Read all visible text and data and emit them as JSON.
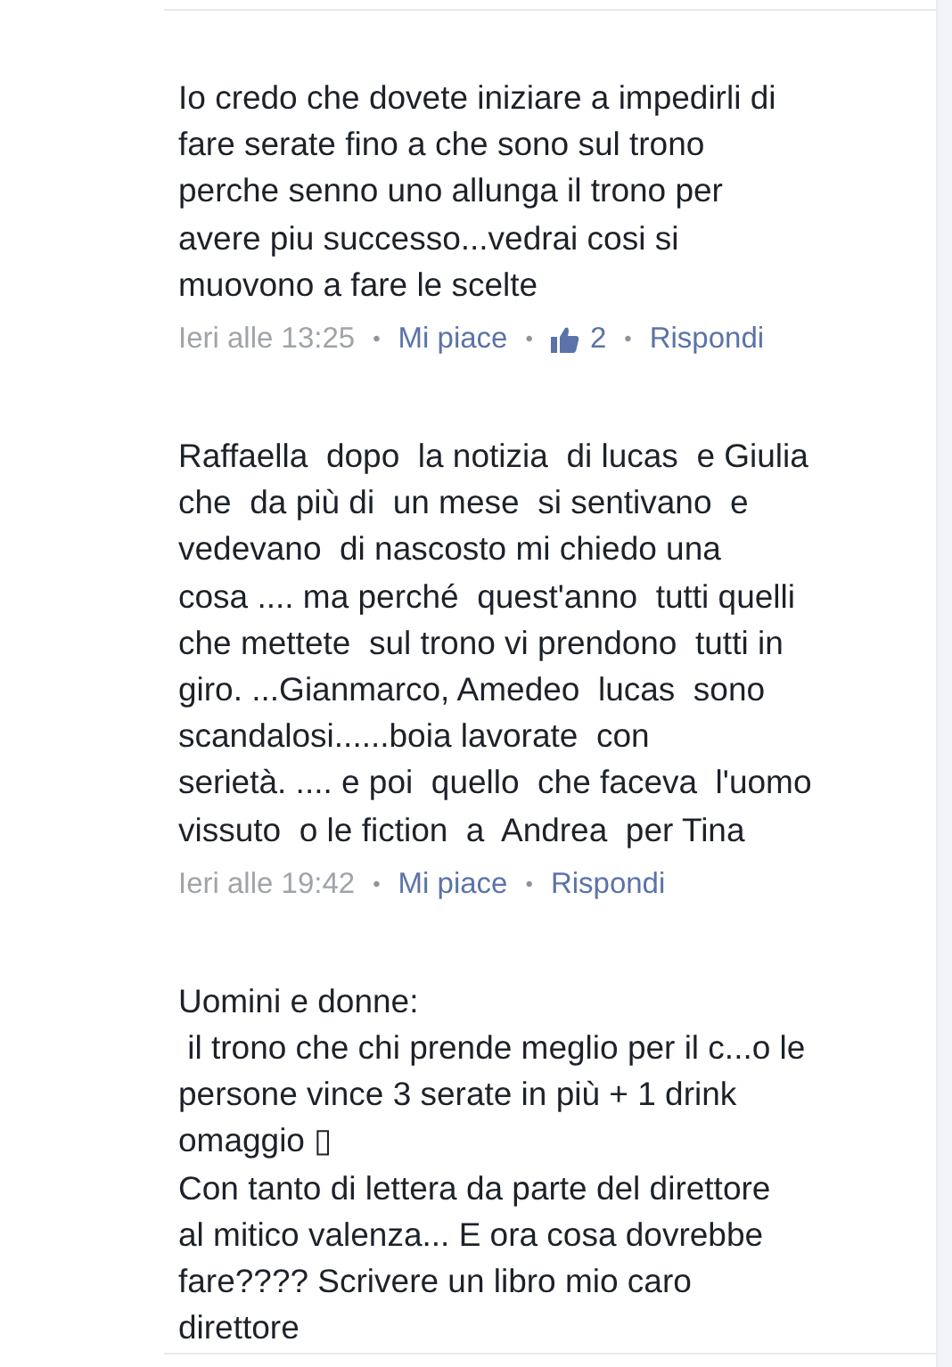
{
  "separator": "•",
  "comments": [
    {
      "text": "Io credo che dovete iniziare a impedirli di\nfare serate fino a che sono sul trono\nperche senno uno allunga il trono per\navere piu successo...vedrai cosi si\nmuovono a fare le scelte",
      "time": "Ieri alle 13:25",
      "like_label": "Mi piace",
      "likes": "2",
      "reply_label": "Rispondi"
    },
    {
      "text": "Raffaella  dopo  la notizia  di lucas  e Giulia\nche  da più di  un mese  si sentivano  e\nvedevano  di nascosto mi chiedo una\ncosa .... ma perché  quest'anno  tutti quelli\nche mettete  sul trono vi prendono  tutti in\ngiro. ...Gianmarco, Amedeo  lucas  sono\nscandalosi......boia lavorate  con\nserietà. .... e poi  quello  che faceva  l'uomo\nvissuto  o le fiction  a  Andrea  per Tina",
      "time": "Ieri alle 19:42",
      "like_label": "Mi piace",
      "reply_label": "Rispondi"
    },
    {
      "text": "Uomini e donne:\n il trono che chi prende meglio per il c...o le\npersone vince 3 serate in più + 1 drink\nomaggio ▯\nCon tanto di lettera da parte del direttore\nal mitico valenza... E ora cosa dovrebbe\nfare???? Scrivere un libro mio caro\ndirettore"
    }
  ]
}
